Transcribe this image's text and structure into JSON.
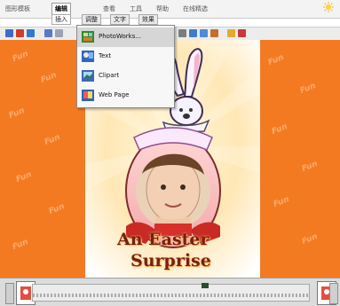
{
  "menubar": {
    "items": [
      {
        "label": "图形模板"
      },
      {
        "label": "编辑"
      },
      {
        "label": "查看"
      },
      {
        "label": "工具"
      },
      {
        "label": "帮助"
      },
      {
        "label": "在线精选"
      }
    ]
  },
  "subtabs": {
    "items": [
      {
        "label": "插入"
      },
      {
        "label": "调整"
      },
      {
        "label": "文字"
      },
      {
        "label": "效果"
      }
    ]
  },
  "dropdown": {
    "items": [
      {
        "label": "PhotoWorks...",
        "icon": "photo-library-icon"
      },
      {
        "label": "Text",
        "icon": "text-icon"
      },
      {
        "label": "Clipart",
        "icon": "clipart-icon"
      },
      {
        "label": "Web Page",
        "icon": "web-icon"
      }
    ]
  },
  "canvas": {
    "line1": "An Easter",
    "line2": "Surprise",
    "pattern_word": "Fun"
  },
  "colors": {
    "canvas_bg": "#f47a22",
    "title_text": "#7a1f10"
  }
}
